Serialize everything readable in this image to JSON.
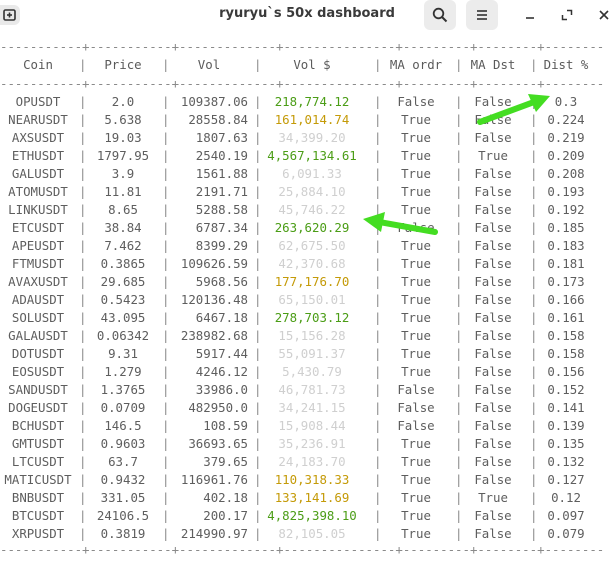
{
  "window": {
    "title": "ryuryu`s 50x dashboard",
    "left_icon": "new-tab-icon",
    "buttons": [
      {
        "name": "search-icon"
      },
      {
        "name": "hamburger-menu-icon"
      },
      {
        "name": "minimize-icon"
      },
      {
        "name": "maximize-icon"
      },
      {
        "name": "close-icon"
      }
    ]
  },
  "table": {
    "headers": [
      "Coin",
      "Price",
      "Vol",
      "Vol $",
      "MA ordr",
      "MA Dst",
      "Dist %"
    ],
    "rows": [
      {
        "coin": "OPUSDT",
        "price": "2.0",
        "vol": "109387.06",
        "vol_usd": "218,774.12",
        "vol_usd_color": "green",
        "ma_ordr": "False",
        "ma_dst": "False",
        "dist": "0.3"
      },
      {
        "coin": "NEARUSDT",
        "price": "5.638",
        "vol": "28558.84",
        "vol_usd": "161,014.74",
        "vol_usd_color": "yellow",
        "ma_ordr": "True",
        "ma_dst": "False",
        "dist": "0.224"
      },
      {
        "coin": "AXSUSDT",
        "price": "19.03",
        "vol": "1807.63",
        "vol_usd": "34,399.20",
        "vol_usd_color": "faint",
        "ma_ordr": "True",
        "ma_dst": "False",
        "dist": "0.219"
      },
      {
        "coin": "ETHUSDT",
        "price": "1797.95",
        "vol": "2540.19",
        "vol_usd": "4,567,134.61",
        "vol_usd_color": "green",
        "ma_ordr": "True",
        "ma_dst": "True",
        "dist": "0.209"
      },
      {
        "coin": "GALUSDT",
        "price": "3.9",
        "vol": "1561.88",
        "vol_usd": "6,091.33",
        "vol_usd_color": "faint",
        "ma_ordr": "True",
        "ma_dst": "False",
        "dist": "0.208"
      },
      {
        "coin": "ATOMUSDT",
        "price": "11.81",
        "vol": "2191.71",
        "vol_usd": "25,884.10",
        "vol_usd_color": "faint",
        "ma_ordr": "True",
        "ma_dst": "False",
        "dist": "0.193"
      },
      {
        "coin": "LINKUSDT",
        "price": "8.65",
        "vol": "5288.58",
        "vol_usd": "45,746.22",
        "vol_usd_color": "faint",
        "ma_ordr": "True",
        "ma_dst": "False",
        "dist": "0.192"
      },
      {
        "coin": "ETCUSDT",
        "price": "38.84",
        "vol": "6787.34",
        "vol_usd": "263,620.29",
        "vol_usd_color": "green",
        "ma_ordr": "False",
        "ma_dst": "False",
        "dist": "0.185"
      },
      {
        "coin": "APEUSDT",
        "price": "7.462",
        "vol": "8399.29",
        "vol_usd": "62,675.50",
        "vol_usd_color": "faint",
        "ma_ordr": "True",
        "ma_dst": "False",
        "dist": "0.183"
      },
      {
        "coin": "FTMUSDT",
        "price": "0.3865",
        "vol": "109626.59",
        "vol_usd": "42,370.68",
        "vol_usd_color": "faint",
        "ma_ordr": "True",
        "ma_dst": "False",
        "dist": "0.181"
      },
      {
        "coin": "AVAXUSDT",
        "price": "29.685",
        "vol": "5968.56",
        "vol_usd": "177,176.70",
        "vol_usd_color": "yellow",
        "ma_ordr": "True",
        "ma_dst": "False",
        "dist": "0.173"
      },
      {
        "coin": "ADAUSDT",
        "price": "0.5423",
        "vol": "120136.48",
        "vol_usd": "65,150.01",
        "vol_usd_color": "faint",
        "ma_ordr": "True",
        "ma_dst": "False",
        "dist": "0.166"
      },
      {
        "coin": "SOLUSDT",
        "price": "43.095",
        "vol": "6467.18",
        "vol_usd": "278,703.12",
        "vol_usd_color": "green",
        "ma_ordr": "True",
        "ma_dst": "False",
        "dist": "0.161"
      },
      {
        "coin": "GALAUSDT",
        "price": "0.06342",
        "vol": "238982.68",
        "vol_usd": "15,156.28",
        "vol_usd_color": "faint",
        "ma_ordr": "True",
        "ma_dst": "False",
        "dist": "0.158"
      },
      {
        "coin": "DOTUSDT",
        "price": "9.31",
        "vol": "5917.44",
        "vol_usd": "55,091.37",
        "vol_usd_color": "faint",
        "ma_ordr": "True",
        "ma_dst": "False",
        "dist": "0.158"
      },
      {
        "coin": "EOSUSDT",
        "price": "1.279",
        "vol": "4246.12",
        "vol_usd": "5,430.79",
        "vol_usd_color": "faint",
        "ma_ordr": "True",
        "ma_dst": "False",
        "dist": "0.156"
      },
      {
        "coin": "SANDUSDT",
        "price": "1.3765",
        "vol": "33986.0",
        "vol_usd": "46,781.73",
        "vol_usd_color": "faint",
        "ma_ordr": "False",
        "ma_dst": "False",
        "dist": "0.152"
      },
      {
        "coin": "DOGEUSDT",
        "price": "0.0709",
        "vol": "482950.0",
        "vol_usd": "34,241.15",
        "vol_usd_color": "faint",
        "ma_ordr": "False",
        "ma_dst": "False",
        "dist": "0.141"
      },
      {
        "coin": "BCHUSDT",
        "price": "146.5",
        "vol": "108.59",
        "vol_usd": "15,908.44",
        "vol_usd_color": "faint",
        "ma_ordr": "False",
        "ma_dst": "False",
        "dist": "0.139"
      },
      {
        "coin": "GMTUSDT",
        "price": "0.9603",
        "vol": "36693.65",
        "vol_usd": "35,236.91",
        "vol_usd_color": "faint",
        "ma_ordr": "True",
        "ma_dst": "False",
        "dist": "0.135"
      },
      {
        "coin": "LTCUSDT",
        "price": "63.7",
        "vol": "379.65",
        "vol_usd": "24,183.70",
        "vol_usd_color": "faint",
        "ma_ordr": "True",
        "ma_dst": "False",
        "dist": "0.132"
      },
      {
        "coin": "MATICUSDT",
        "price": "0.9432",
        "vol": "116961.76",
        "vol_usd": "110,318.33",
        "vol_usd_color": "yellow",
        "ma_ordr": "True",
        "ma_dst": "False",
        "dist": "0.127"
      },
      {
        "coin": "BNBUSDT",
        "price": "331.05",
        "vol": "402.18",
        "vol_usd": "133,141.69",
        "vol_usd_color": "yellow",
        "ma_ordr": "True",
        "ma_dst": "True",
        "dist": "0.12"
      },
      {
        "coin": "BTCUSDT",
        "price": "24106.5",
        "vol": "200.17",
        "vol_usd": "4,825,398.10",
        "vol_usd_color": "green",
        "ma_ordr": "True",
        "ma_dst": "False",
        "dist": "0.097"
      },
      {
        "coin": "XRPUSDT",
        "price": "0.3819",
        "vol": "214990.97",
        "vol_usd": "82,105.05",
        "vol_usd_color": "faint",
        "ma_ordr": "True",
        "ma_dst": "False",
        "dist": "0.079"
      }
    ]
  },
  "colors": {
    "green": "#4b9d16",
    "yellow": "#c49a07",
    "faint": "#cfcfcf",
    "arrow": "#44dd22"
  }
}
